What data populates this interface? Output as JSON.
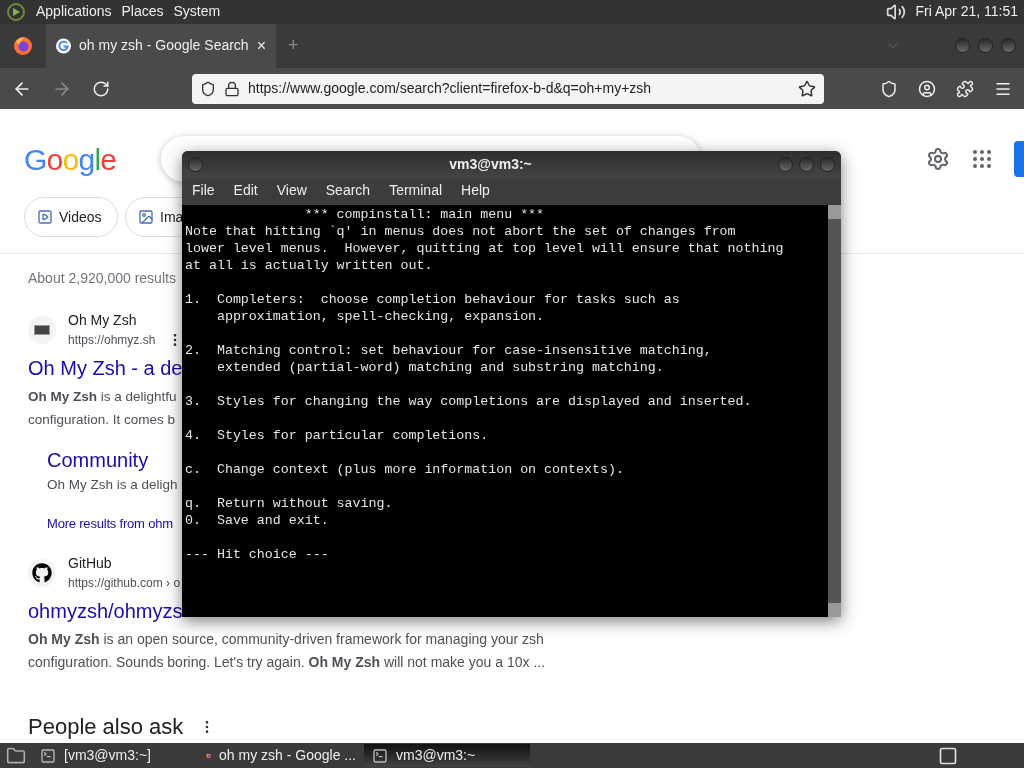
{
  "top_panel": {
    "menus": [
      "Applications",
      "Places",
      "System"
    ],
    "clock": "Fri Apr 21, 11:51"
  },
  "browser": {
    "tab": {
      "title": "oh my zsh - Google Search",
      "close": "×"
    },
    "new_tab": "+",
    "url": "https://www.google.com/search?client=firefox-b-d&q=oh+my+zsh",
    "forward_disabled": true
  },
  "google": {
    "logo": "Google",
    "chips": [
      {
        "label": "Videos",
        "kind": "video"
      },
      {
        "label": "Ima",
        "kind": "image"
      }
    ],
    "result_count": "About 2,920,000 results",
    "results": [
      {
        "site": "Oh My Zsh",
        "url": "https://ohmyz.sh",
        "kind": "terminal",
        "title": "Oh My Zsh - a de",
        "snippet": [
          "**Oh My Zsh** is a delightfu",
          "configuration. It comes b"
        ],
        "sitelink": {
          "title": "Community",
          "snippet": "Oh My Zsh is a deligh"
        },
        "more": "More results from ohm"
      },
      {
        "site": "GitHub",
        "url": "https://github.com › o",
        "kind": "github",
        "title": "ohmyzsh/ohmyzs",
        "snippet": [
          "**Oh My Zsh** is an open source, community-driven framework for managing your zsh configuration. Sounds boring. Let's try again. **Oh My Zsh** will not make you a 10x ..."
        ]
      }
    ],
    "people_also_ask": "People also ask"
  },
  "terminal": {
    "title": "vm3@vm3:~",
    "menu": [
      "File",
      "Edit",
      "View",
      "Search",
      "Terminal",
      "Help"
    ],
    "blocks": [
      [
        "               *** compinstall: main menu ***",
        "Note that hitting `q' in menus does not abort the set of changes from",
        "lower level menus.  However, quitting at top level will ensure that nothing",
        "at all is actually written out."
      ],
      [
        "1.  Completers:  choose completion behaviour for tasks such as",
        "    approximation, spell-checking, expansion."
      ],
      [
        "2.  Matching control: set behaviour for case-insensitive matching,",
        "    extended (partial-word) matching and substring matching."
      ],
      [
        "3.  Styles for changing the way completions are displayed and inserted."
      ],
      [
        "4.  Styles for particular completions."
      ],
      [
        "c.  Change context (plus more information on contexts)."
      ],
      [
        "q.  Return without saving.",
        "0.  Save and exit."
      ],
      [
        "--- Hit choice ---"
      ]
    ]
  },
  "taskbar": [
    {
      "label": "[vm3@vm3:~]",
      "kind": "terminal",
      "selected": false
    },
    {
      "label": "oh my zsh - Google ...",
      "kind": "browser",
      "selected": false
    },
    {
      "label": "vm3@vm3:~",
      "kind": "terminal",
      "selected": true
    }
  ]
}
